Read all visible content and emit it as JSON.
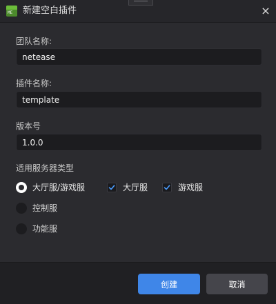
{
  "window": {
    "title": "新建空白插件",
    "icon_text": "ME",
    "close_glyph": "×"
  },
  "form": {
    "team_name_label": "团队名称:",
    "team_name_value": "netease",
    "plugin_name_label": "插件名称:",
    "plugin_name_value": "template",
    "version_label": "版本号",
    "version_value": "1.0.0"
  },
  "server_types": {
    "label": "适用服务器类型",
    "options": [
      {
        "label": "大厅服/游戏服",
        "selected": true
      },
      {
        "label": "控制服",
        "selected": false
      },
      {
        "label": "功能服",
        "selected": false
      }
    ],
    "sub_options": [
      {
        "label": "大厅服",
        "checked": true
      },
      {
        "label": "游戏服",
        "checked": true
      }
    ]
  },
  "footer": {
    "create_label": "创建",
    "cancel_label": "取消"
  },
  "colors": {
    "accent": "#3f86e8",
    "checkmark": "#4a9cff",
    "background": "#2b2b2f",
    "input_bg": "#1c1c1f"
  }
}
